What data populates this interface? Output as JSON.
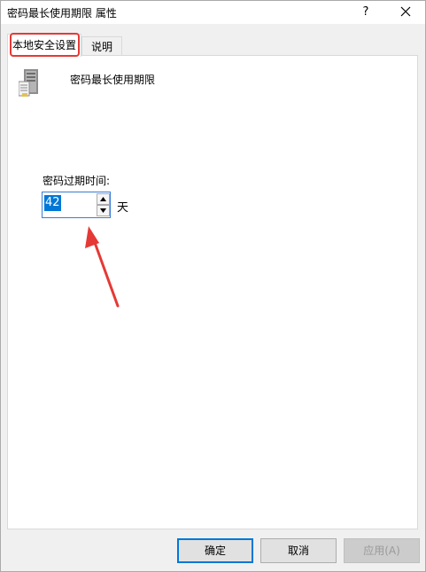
{
  "window": {
    "title": "密码最长使用期限 属性",
    "help_label": "?",
    "close_icon": "close-icon"
  },
  "tabs": [
    {
      "label": "本地安全设置",
      "active": true
    },
    {
      "label": "说明",
      "active": false
    }
  ],
  "panel": {
    "policy_icon": "server-icon",
    "policy_name": "密码最长使用期限",
    "expire_label": "密码过期时间:",
    "expire_value": "42",
    "expire_unit": "天"
  },
  "buttons": {
    "ok_label": "确定",
    "cancel_label": "取消",
    "apply_label": "应用(A)"
  },
  "colors": {
    "annotation_red": "#e53935",
    "selection_blue": "#0078d7"
  }
}
